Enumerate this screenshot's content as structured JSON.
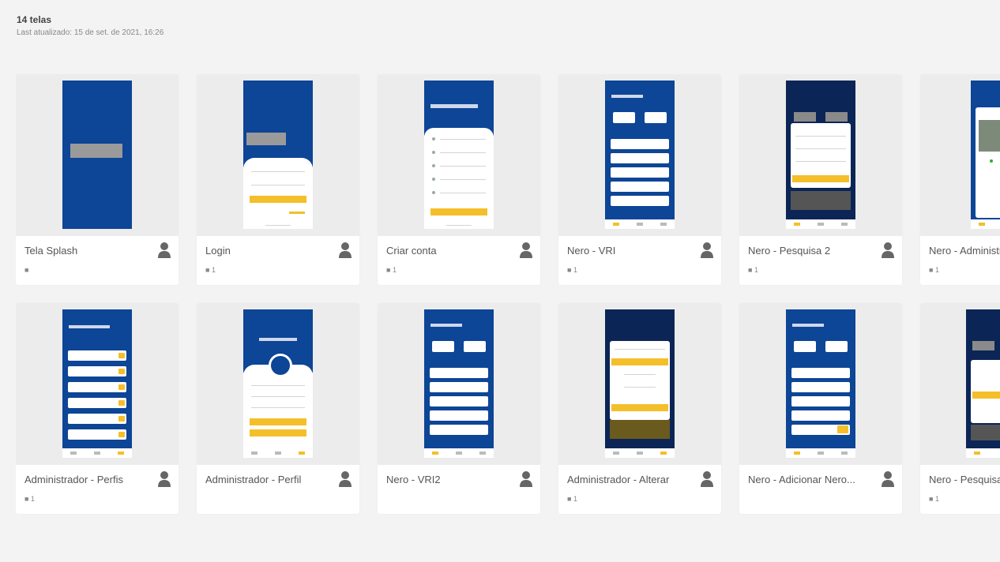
{
  "header": {
    "title": "14 telas",
    "subtitle": "Last atualizado: 15 de set. de 2021, 16:26"
  },
  "colors": {
    "brand_blue": "#0d4597",
    "navy": "#0b2556",
    "accent_yellow": "#f5bf2a",
    "thumb_bg": "#ececec"
  },
  "cards": [
    {
      "name": "Tela Splash",
      "count": ""
    },
    {
      "name": "Login",
      "count": "1"
    },
    {
      "name": "Criar conta",
      "count": "1"
    },
    {
      "name": "Nero - VRI",
      "count": "1"
    },
    {
      "name": "Nero - Pesquisa 2",
      "count": "1"
    },
    {
      "name": "Nero - Administrador",
      "count": "1"
    },
    {
      "name": "Administrador - Perfis",
      "count": "1"
    },
    {
      "name": "Administrador - Perfil",
      "count": ""
    },
    {
      "name": "Nero - VRI2",
      "count": ""
    },
    {
      "name": "Administrador - Alterar",
      "count": "1"
    },
    {
      "name": "Nero - Adicionar Nero...",
      "count": ""
    },
    {
      "name": "Nero - Pesquisa",
      "count": "1"
    }
  ]
}
